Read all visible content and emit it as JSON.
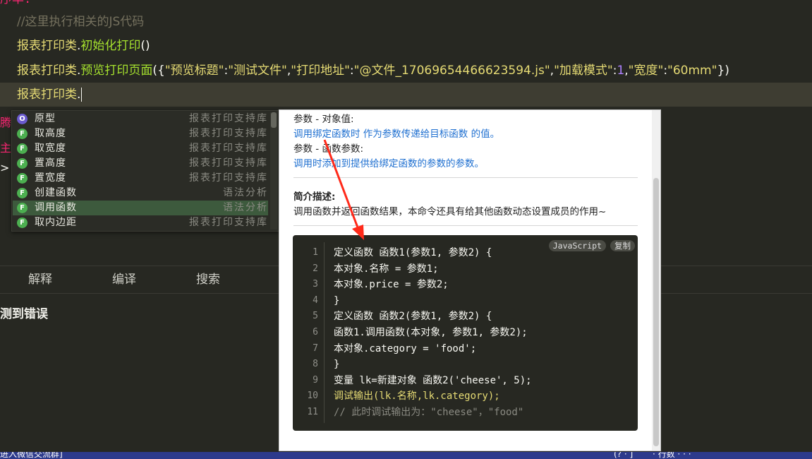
{
  "editor": {
    "top_fragment": "序率:",
    "lines": {
      "comment": "//这里执行相关的JS代码",
      "l2_obj": "报表打印类",
      "l2_dot": ".",
      "l2_fn": "初始化打印",
      "l2_paren": "()",
      "l3_obj": "报表打印类",
      "l3_dot": ".",
      "l3_fn": "预览打印页面",
      "l3_open": "({",
      "l3_k1": "\"预览标题\"",
      "l3_c1": ":",
      "l3_v1": "\"测试文件\"",
      "l3_s1": ",",
      "l3_k2": "\"打印地址\"",
      "l3_c2": ":",
      "l3_v2": "\"@文件_17069654466623594.js\"",
      "l3_s2": ",",
      "l3_k3": "\"加载模式\"",
      "l3_c3": ":",
      "l3_v3": "1",
      "l3_s3": ",",
      "l3_k4": "\"宽度\"",
      "l3_c4": ":",
      "l3_v4": "\"60mm\"",
      "l3_close": "})",
      "l4_obj": "报表打印类",
      "l4_dot": "."
    },
    "left_fragments": [
      "腾",
      "主",
      ">"
    ]
  },
  "autocomplete": {
    "items": [
      {
        "kind": "O",
        "name": "原型",
        "source": "报表打印支持库"
      },
      {
        "kind": "F",
        "name": "取高度",
        "source": "报表打印支持库"
      },
      {
        "kind": "F",
        "name": "取宽度",
        "source": "报表打印支持库"
      },
      {
        "kind": "F",
        "name": "置高度",
        "source": "报表打印支持库"
      },
      {
        "kind": "F",
        "name": "置宽度",
        "source": "报表打印支持库"
      },
      {
        "kind": "F",
        "name": "创建函数",
        "source": "语法分析"
      },
      {
        "kind": "F",
        "name": "调用函数",
        "source": "语法分析"
      },
      {
        "kind": "F",
        "name": "取内边距",
        "source": "报表打印支持库"
      }
    ],
    "selected_index": 6
  },
  "doc": {
    "param1_label": "参数 - 对象值:",
    "param1_desc": "调用绑定函数时 作为参数传递给目标函数 的值。",
    "param2_label": "参数 - 函数参数:",
    "param2_desc": "调用时添加到提供给绑定函数的参数的参数。",
    "summary_title": "简介描述:",
    "summary_text": "调用函数并返回函数结果，本命令还具有给其他函数动态设置成员的作用~",
    "code_lang": "JavaScript",
    "code_copy": "复制",
    "code_lines": [
      {
        "n": "1",
        "t": "定义函数 函数1(参数1, 参数2) {"
      },
      {
        "n": "2",
        "t": "  本对象.名称 = 参数1;"
      },
      {
        "n": "3",
        "t": "  本对象.price = 参数2;"
      },
      {
        "n": "4",
        "t": "}"
      },
      {
        "n": "5",
        "t": "定义函数 函数2(参数1, 参数2) {"
      },
      {
        "n": "6",
        "t": "  函数1.调用函数(本对象, 参数1, 参数2);"
      },
      {
        "n": "7",
        "t": "  本对象.category = 'food';"
      },
      {
        "n": "8",
        "t": "}"
      },
      {
        "n": "9",
        "t": "变量 lk=新建对象 函数2('cheese', 5);"
      },
      {
        "n": "10",
        "t": "调试输出(lk.名称,lk.category);"
      },
      {
        "n": "11",
        "t": "// 此时调试输出为：\"cheese\"，\"food\""
      }
    ]
  },
  "panel": {
    "tabs": [
      "解释",
      "编译",
      "搜索"
    ],
    "message": "测到错误"
  },
  "statusbar": {
    "left": "进入微信交流群]",
    "right": "(?  ·  ]    ·  行数  ·  ·  · "
  },
  "colors": {
    "editor_bg": "#272822",
    "selected_item": "#3d5a3d",
    "link": "#1e6fd0",
    "status_bg": "#2d3a8c",
    "arrow": "#ff2a1a"
  }
}
